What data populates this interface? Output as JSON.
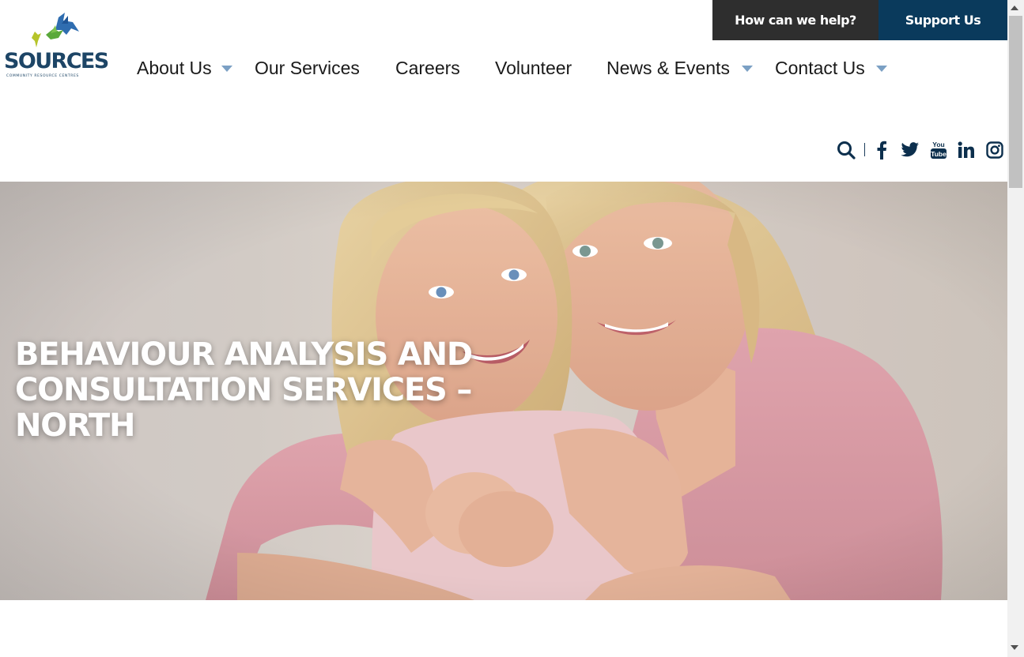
{
  "header": {
    "help_button": "How can we help?",
    "support_button": "Support Us",
    "logo": {
      "word": "SOURCES",
      "tagline": "COMMUNITY RESOURCE CENTRES"
    }
  },
  "nav": {
    "items": [
      {
        "label": "About Us",
        "has_dropdown": true
      },
      {
        "label": "Our Services",
        "has_dropdown": false
      },
      {
        "label": "Careers",
        "has_dropdown": false
      },
      {
        "label": "Volunteer",
        "has_dropdown": false
      },
      {
        "label": "News & Events",
        "has_dropdown": true
      },
      {
        "label": "Contact Us",
        "has_dropdown": true
      }
    ]
  },
  "social": {
    "icons": [
      "search-icon",
      "facebook-icon",
      "twitter-icon",
      "youtube-icon",
      "linkedin-icon",
      "instagram-icon"
    ]
  },
  "hero": {
    "title": "BEHAVIOUR ANALYSIS AND CONSULTATION SERVICES – NORTH"
  },
  "colors": {
    "brand_navy": "#0a3a5c",
    "dark_button": "#2e2e2e",
    "caret": "#7ba0c4",
    "logo_text": "#1d4566"
  }
}
